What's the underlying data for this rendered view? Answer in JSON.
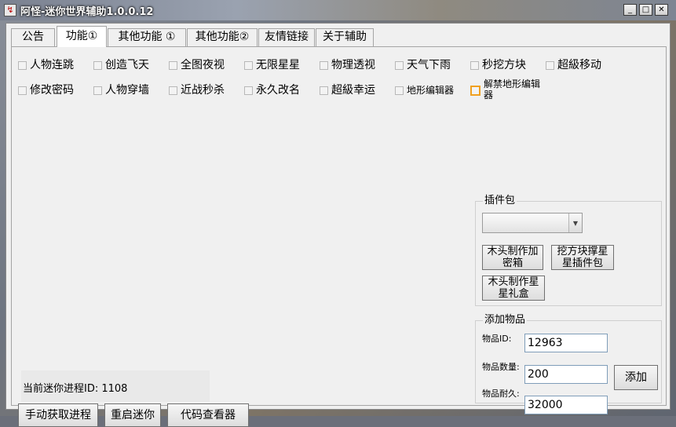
{
  "window": {
    "title": "阿怪-迷你世界辅助1.0.0.12",
    "icon_glyph": "↯",
    "controls": {
      "minimize": "_",
      "maximize": "□",
      "close": "✕"
    }
  },
  "tabs": [
    {
      "label": "公告",
      "active": false
    },
    {
      "label": "功能①",
      "active": true
    },
    {
      "label": "其他功能 ①",
      "active": false
    },
    {
      "label": "其他功能②",
      "active": false
    },
    {
      "label": "友情链接",
      "active": false
    },
    {
      "label": "关于辅助",
      "active": false
    }
  ],
  "features": {
    "row1": [
      "人物连跳",
      "创造飞天",
      "全图夜视",
      "无限星星",
      "物理透视",
      "天气下雨",
      "秒挖方块",
      "超級移动"
    ],
    "row2": [
      "修改密码",
      "人物穿墙",
      "近战秒杀",
      "永久改名",
      "超級幸运",
      "地形编辑器",
      "解禁地形编辑器"
    ]
  },
  "plugin_pack": {
    "title": "插件包",
    "select_value": "",
    "buttons": [
      "木头制作加密箱",
      "挖方块撑星星插件包",
      "木头制作星星礼盒"
    ]
  },
  "add_item": {
    "title": "添加物品",
    "id_label": "物品ID:",
    "id_value": "12963",
    "qty_label": "物品数量:",
    "qty_value": "200",
    "dur_label": "物品耐久:",
    "dur_value": "32000",
    "add_button": "添加"
  },
  "status": {
    "process_text": "当前迷你进程ID: 1108"
  },
  "bottom_buttons": {
    "get_process": "手动获取进程",
    "restart": "重启迷你",
    "code_viewer": "代码查看器"
  },
  "colors": {
    "highlight_checkbox": "#f0a020"
  }
}
